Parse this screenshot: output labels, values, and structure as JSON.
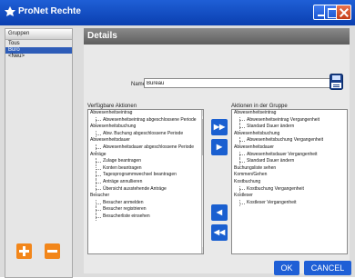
{
  "window": {
    "title": "ProNet Rechte",
    "colors": {
      "titlebar": "#1f5fd6",
      "accent_orange": "#f2861a",
      "selection": "#2d5cb8"
    }
  },
  "left_panel": {
    "header": "Gruppen",
    "items": [
      "Tous",
      "Büro",
      "<Neu>"
    ],
    "selected_index": 1,
    "add_icon": "plus-icon",
    "remove_icon": "minus-icon"
  },
  "details": {
    "title": "Details",
    "name_label": "Name",
    "name_value": "Bureau",
    "save_icon": "save-icon",
    "available_label": "Verfügbare Aktionen",
    "group_actions_label": "Aktionen in der Gruppe",
    "available": [
      {
        "text": "Abwesenheitseintrag",
        "level": 0
      },
      {
        "text": "Abwesenheitseintrag abgeschlossene Periode",
        "level": 1
      },
      {
        "text": "Abwesenheitsbuchung",
        "level": 0
      },
      {
        "text": "Abw. Buchung abgeschlossene Periode",
        "level": 1
      },
      {
        "text": "Abwesenheitsdauer",
        "level": 0
      },
      {
        "text": "Abwesenheitsdauer abgeschlossene Periode",
        "level": 1
      },
      {
        "text": "Anträge",
        "level": 0
      },
      {
        "text": "Zulage beantragen",
        "level": 1
      },
      {
        "text": "Konten beantragen",
        "level": 1
      },
      {
        "text": "Tagesprogrammwechsel beantragen",
        "level": 1
      },
      {
        "text": "Anträge annullieren",
        "level": 1
      },
      {
        "text": "Übersicht ausstehende Anträge",
        "level": 1
      },
      {
        "text": "Besucher",
        "level": 0
      },
      {
        "text": "Besucher anmelden",
        "level": 1
      },
      {
        "text": "Besucher registrieren",
        "level": 1
      },
      {
        "text": "Besucherliste einsehen",
        "level": 1
      }
    ],
    "group_actions": [
      {
        "text": "Abwesenheitseintrag",
        "level": 0
      },
      {
        "text": "Abwesenheitseintrag Vergangenheit",
        "level": 1
      },
      {
        "text": "Standard Dauer ändern",
        "level": 1
      },
      {
        "text": "Abwesenheitsbuchung",
        "level": 0
      },
      {
        "text": "Abwesenheitsbuchung Vergangenheit",
        "level": 1
      },
      {
        "text": "Abwesenheitsdauer",
        "level": 0
      },
      {
        "text": "Abwesenheitsdauer Vergangenheit",
        "level": 1
      },
      {
        "text": "Standard Dauer ändern",
        "level": 1
      },
      {
        "text": "Buchungsliste sehen",
        "level": 0
      },
      {
        "text": "Kommen/Gehen",
        "level": 0
      },
      {
        "text": "Kostbuchung",
        "level": 0
      },
      {
        "text": "Kostbuchung Vergangenheit",
        "level": 1
      },
      {
        "text": "Kostleser",
        "level": 0
      },
      {
        "text": "Kostleser Vergangenheit",
        "level": 1
      }
    ],
    "arrows": [
      "▶▶",
      "▶",
      "◀",
      "◀◀"
    ]
  },
  "footer": {
    "ok": "OK",
    "cancel": "CANCEL"
  }
}
